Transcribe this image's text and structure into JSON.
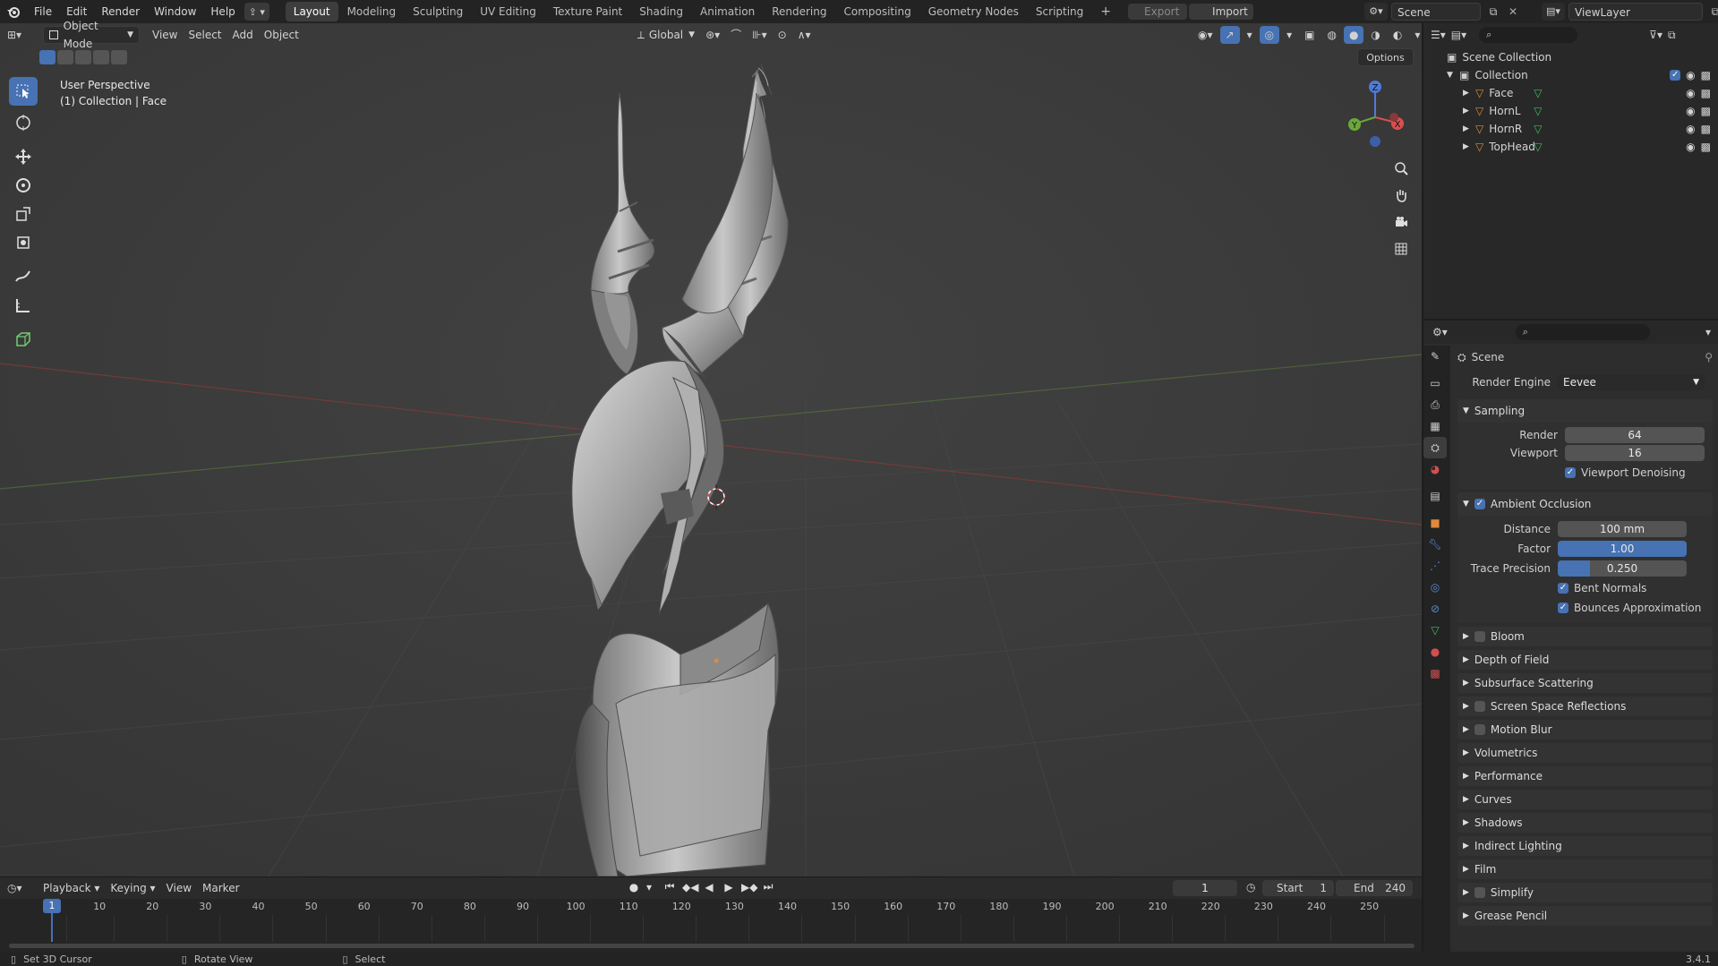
{
  "topbar": {
    "menus": [
      "File",
      "Edit",
      "Render",
      "Window",
      "Help"
    ],
    "workspaces": [
      "Layout",
      "Modeling",
      "Sculpting",
      "UV Editing",
      "Texture Paint",
      "Shading",
      "Animation",
      "Rendering",
      "Compositing",
      "Geometry Nodes",
      "Scripting"
    ],
    "active_workspace": "Layout",
    "export_label": "Export",
    "import_label": "Import",
    "scene_name": "Scene",
    "view_layer": "ViewLayer"
  },
  "viewport": {
    "mode": "Object Mode",
    "menus": [
      "View",
      "Select",
      "Add",
      "Object"
    ],
    "transform_orientation": "Global",
    "options_label": "Options",
    "view_name": "User Perspective",
    "context": "(1) Collection | Face",
    "gizmo_labels": [
      "Z",
      "X",
      "Y"
    ]
  },
  "outliner": {
    "root": "Scene Collection",
    "collection": "Collection",
    "objects": [
      "Face",
      "HornL",
      "HornR",
      "TopHead"
    ]
  },
  "properties": {
    "scene_label": "Scene",
    "render_engine_label": "Render Engine",
    "render_engine": "Eevee",
    "sampling": {
      "title": "Sampling",
      "render_label": "Render",
      "render_value": "64",
      "viewport_label": "Viewport",
      "viewport_value": "16",
      "denoise_label": "Viewport Denoising"
    },
    "ao": {
      "title": "Ambient Occlusion",
      "distance_label": "Distance",
      "distance_value": "100 mm",
      "factor_label": "Factor",
      "factor_value": "1.00",
      "trace_label": "Trace Precision",
      "trace_value": "0.250",
      "trace_fill": 0.25,
      "bent_normals": "Bent Normals",
      "bounces": "Bounces Approximation"
    },
    "panels": [
      {
        "label": "Bloom",
        "checkbox": true
      },
      {
        "label": "Depth of Field",
        "checkbox": false
      },
      {
        "label": "Subsurface Scattering",
        "checkbox": false
      },
      {
        "label": "Screen Space Reflections",
        "checkbox": true
      },
      {
        "label": "Motion Blur",
        "checkbox": true
      },
      {
        "label": "Volumetrics",
        "checkbox": false
      },
      {
        "label": "Performance",
        "checkbox": false
      },
      {
        "label": "Curves",
        "checkbox": false
      },
      {
        "label": "Shadows",
        "checkbox": false
      },
      {
        "label": "Indirect Lighting",
        "checkbox": false
      },
      {
        "label": "Film",
        "checkbox": false
      },
      {
        "label": "Simplify",
        "checkbox": true
      },
      {
        "label": "Grease Pencil",
        "checkbox": false
      }
    ]
  },
  "timeline": {
    "menus": [
      "Playback",
      "Keying",
      "View",
      "Marker"
    ],
    "current_frame": "1",
    "start_label": "Start",
    "start_value": "1",
    "end_label": "End",
    "end_value": "240",
    "ticks": [
      "1",
      "10",
      "20",
      "30",
      "40",
      "50",
      "60",
      "70",
      "80",
      "90",
      "100",
      "110",
      "120",
      "130",
      "140",
      "150",
      "160",
      "170",
      "180",
      "190",
      "200",
      "210",
      "220",
      "230",
      "240",
      "250"
    ]
  },
  "statusbar": {
    "hint1": "Set 3D Cursor",
    "hint2": "Rotate View",
    "hint3": "Select",
    "version": "3.4.1"
  },
  "colors": {
    "accent": "#4772b3",
    "viewport_bg": "#3b3b3b",
    "object_orange": "#e08a3c",
    "mesh_green": "#3fbf5f"
  }
}
